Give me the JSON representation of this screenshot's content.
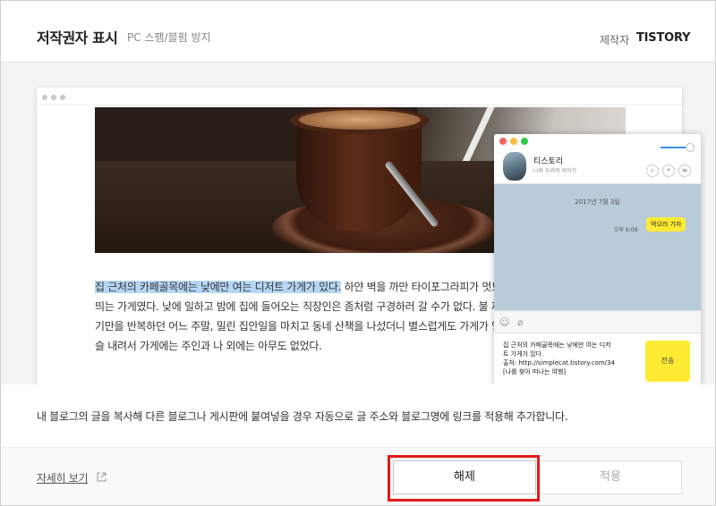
{
  "header": {
    "title": "저작권자 표시",
    "subtitle": "PC 스팸/블펌 방지",
    "maker_label": "제작자",
    "maker_name": "TISTORY"
  },
  "preview": {
    "article_lines": [
      {
        "highlight": "집 근처의 카페골목에는 낮에만 여는 디저트 가게가 있다.",
        "rest": " 하얀 벽을 까만 타이포그라피가 멋드러"
      },
      {
        "highlight": "",
        "rest": "띄는 가게였다. 낮에 일하고 밤에 집에 들어오는 직장인은 좀처럼 구경하러 갈 수가 없다. 불 꺼진"
      },
      {
        "highlight": "",
        "rest": "기만을 반복하던 어느 주말, 밀린 집안일을 마치고 동네 산책을 나섰더니 별스럽게도 가게가 열려"
      },
      {
        "highlight": "",
        "rest": "슬 내려서 가게에는 주인과 나 외에는 아무도 없었다."
      }
    ],
    "chat": {
      "name": "티스토리",
      "status": "나와 우리의 이야기",
      "date": "2017년 7월 3일",
      "time": "오후 6:08",
      "bubble": "먹으러 가자",
      "input_lines": [
        "집 근처의 카페골목에는 낮에만 여는 디저",
        "트 가게가 있다.",
        "출처: http://simplecat.tistory.com/34",
        "[나를 찾아 떠나는 여행]"
      ],
      "send_label": "전송"
    }
  },
  "description": "내 블로그의 글을 복사해 다른 블로그나 게시판에 붙여넣을 경우 자동으로 글 주소와 블로그명에 링크를 적용해 추가합니다.",
  "footer": {
    "detail_link": "자세히 보기",
    "release_label": "해제",
    "apply_label": "적용"
  },
  "colors": {
    "highlight": "#b6d7f4",
    "chat_bg": "#b7cbd9",
    "kakao_yellow": "#ffeb33",
    "annotation_red": "#e21a1a"
  }
}
